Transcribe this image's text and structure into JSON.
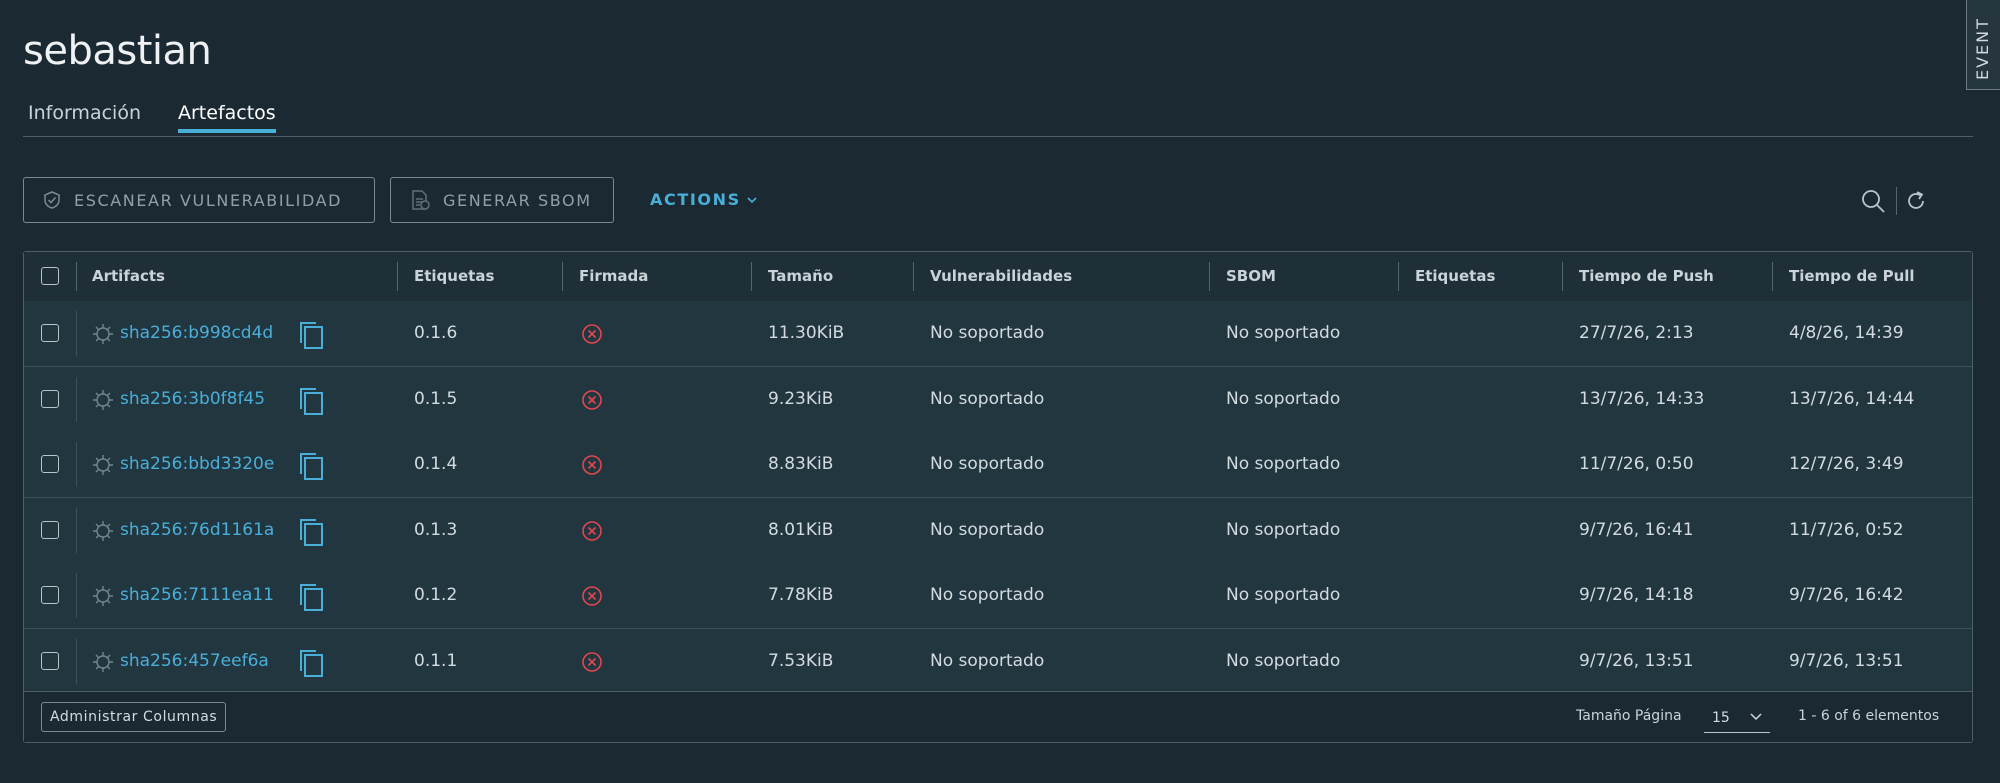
{
  "page": {
    "title": "sebastian"
  },
  "tabs": [
    {
      "label": "Información",
      "active": false
    },
    {
      "label": "Artefactos",
      "active": true
    }
  ],
  "toolbar": {
    "scan_label": "ESCANEAR VULNERABILIDAD",
    "sbom_label": "GENERAR SBOM",
    "actions_label": "ACTIONS",
    "search_icon": "search-icon",
    "refresh_icon": "refresh-icon"
  },
  "table": {
    "columns": [
      "Artifacts",
      "Etiquetas",
      "Firmada",
      "Tamaño",
      "Vulnerabilidades",
      "SBOM",
      "Etiquetas",
      "Tiempo de Push",
      "Tiempo de Pull"
    ],
    "rows": [
      {
        "digest": "sha256:b998cd4d",
        "tag": "0.1.6",
        "size": "11.30KiB",
        "vulns": "No soportado",
        "sbom": "No soportado",
        "labels": "",
        "push": "27/7/26, 2:13",
        "pull": "4/8/26, 14:39"
      },
      {
        "digest": "sha256:3b0f8f45",
        "tag": "0.1.5",
        "size": "9.23KiB",
        "vulns": "No soportado",
        "sbom": "No soportado",
        "labels": "",
        "push": "13/7/26, 14:33",
        "pull": "13/7/26, 14:44"
      },
      {
        "digest": "sha256:bbd3320e",
        "tag": "0.1.4",
        "size": "8.83KiB",
        "vulns": "No soportado",
        "sbom": "No soportado",
        "labels": "",
        "push": "11/7/26, 0:50",
        "pull": "12/7/26, 3:49"
      },
      {
        "digest": "sha256:76d1161a",
        "tag": "0.1.3",
        "size": "8.01KiB",
        "vulns": "No soportado",
        "sbom": "No soportado",
        "labels": "",
        "push": "9/7/26, 16:41",
        "pull": "11/7/26, 0:52"
      },
      {
        "digest": "sha256:7111ea11",
        "tag": "0.1.2",
        "size": "7.78KiB",
        "vulns": "No soportado",
        "sbom": "No soportado",
        "labels": "",
        "push": "9/7/26, 14:18",
        "pull": "9/7/26, 16:42"
      },
      {
        "digest": "sha256:457eef6a",
        "tag": "0.1.1",
        "size": "7.53KiB",
        "vulns": "No soportado",
        "sbom": "No soportado",
        "labels": "",
        "push": "9/7/26, 13:51",
        "pull": "9/7/26, 13:51"
      }
    ]
  },
  "footer": {
    "manage_columns": "Administrar Columnas",
    "page_size_label": "Tamaño Página",
    "page_size_value": "15",
    "count": "1 - 6 of 6 elementos"
  },
  "side_tab": {
    "label": "EVENT"
  },
  "colors": {
    "accent": "#49afd9",
    "danger": "#e2464f",
    "background": "#1b2a32"
  }
}
